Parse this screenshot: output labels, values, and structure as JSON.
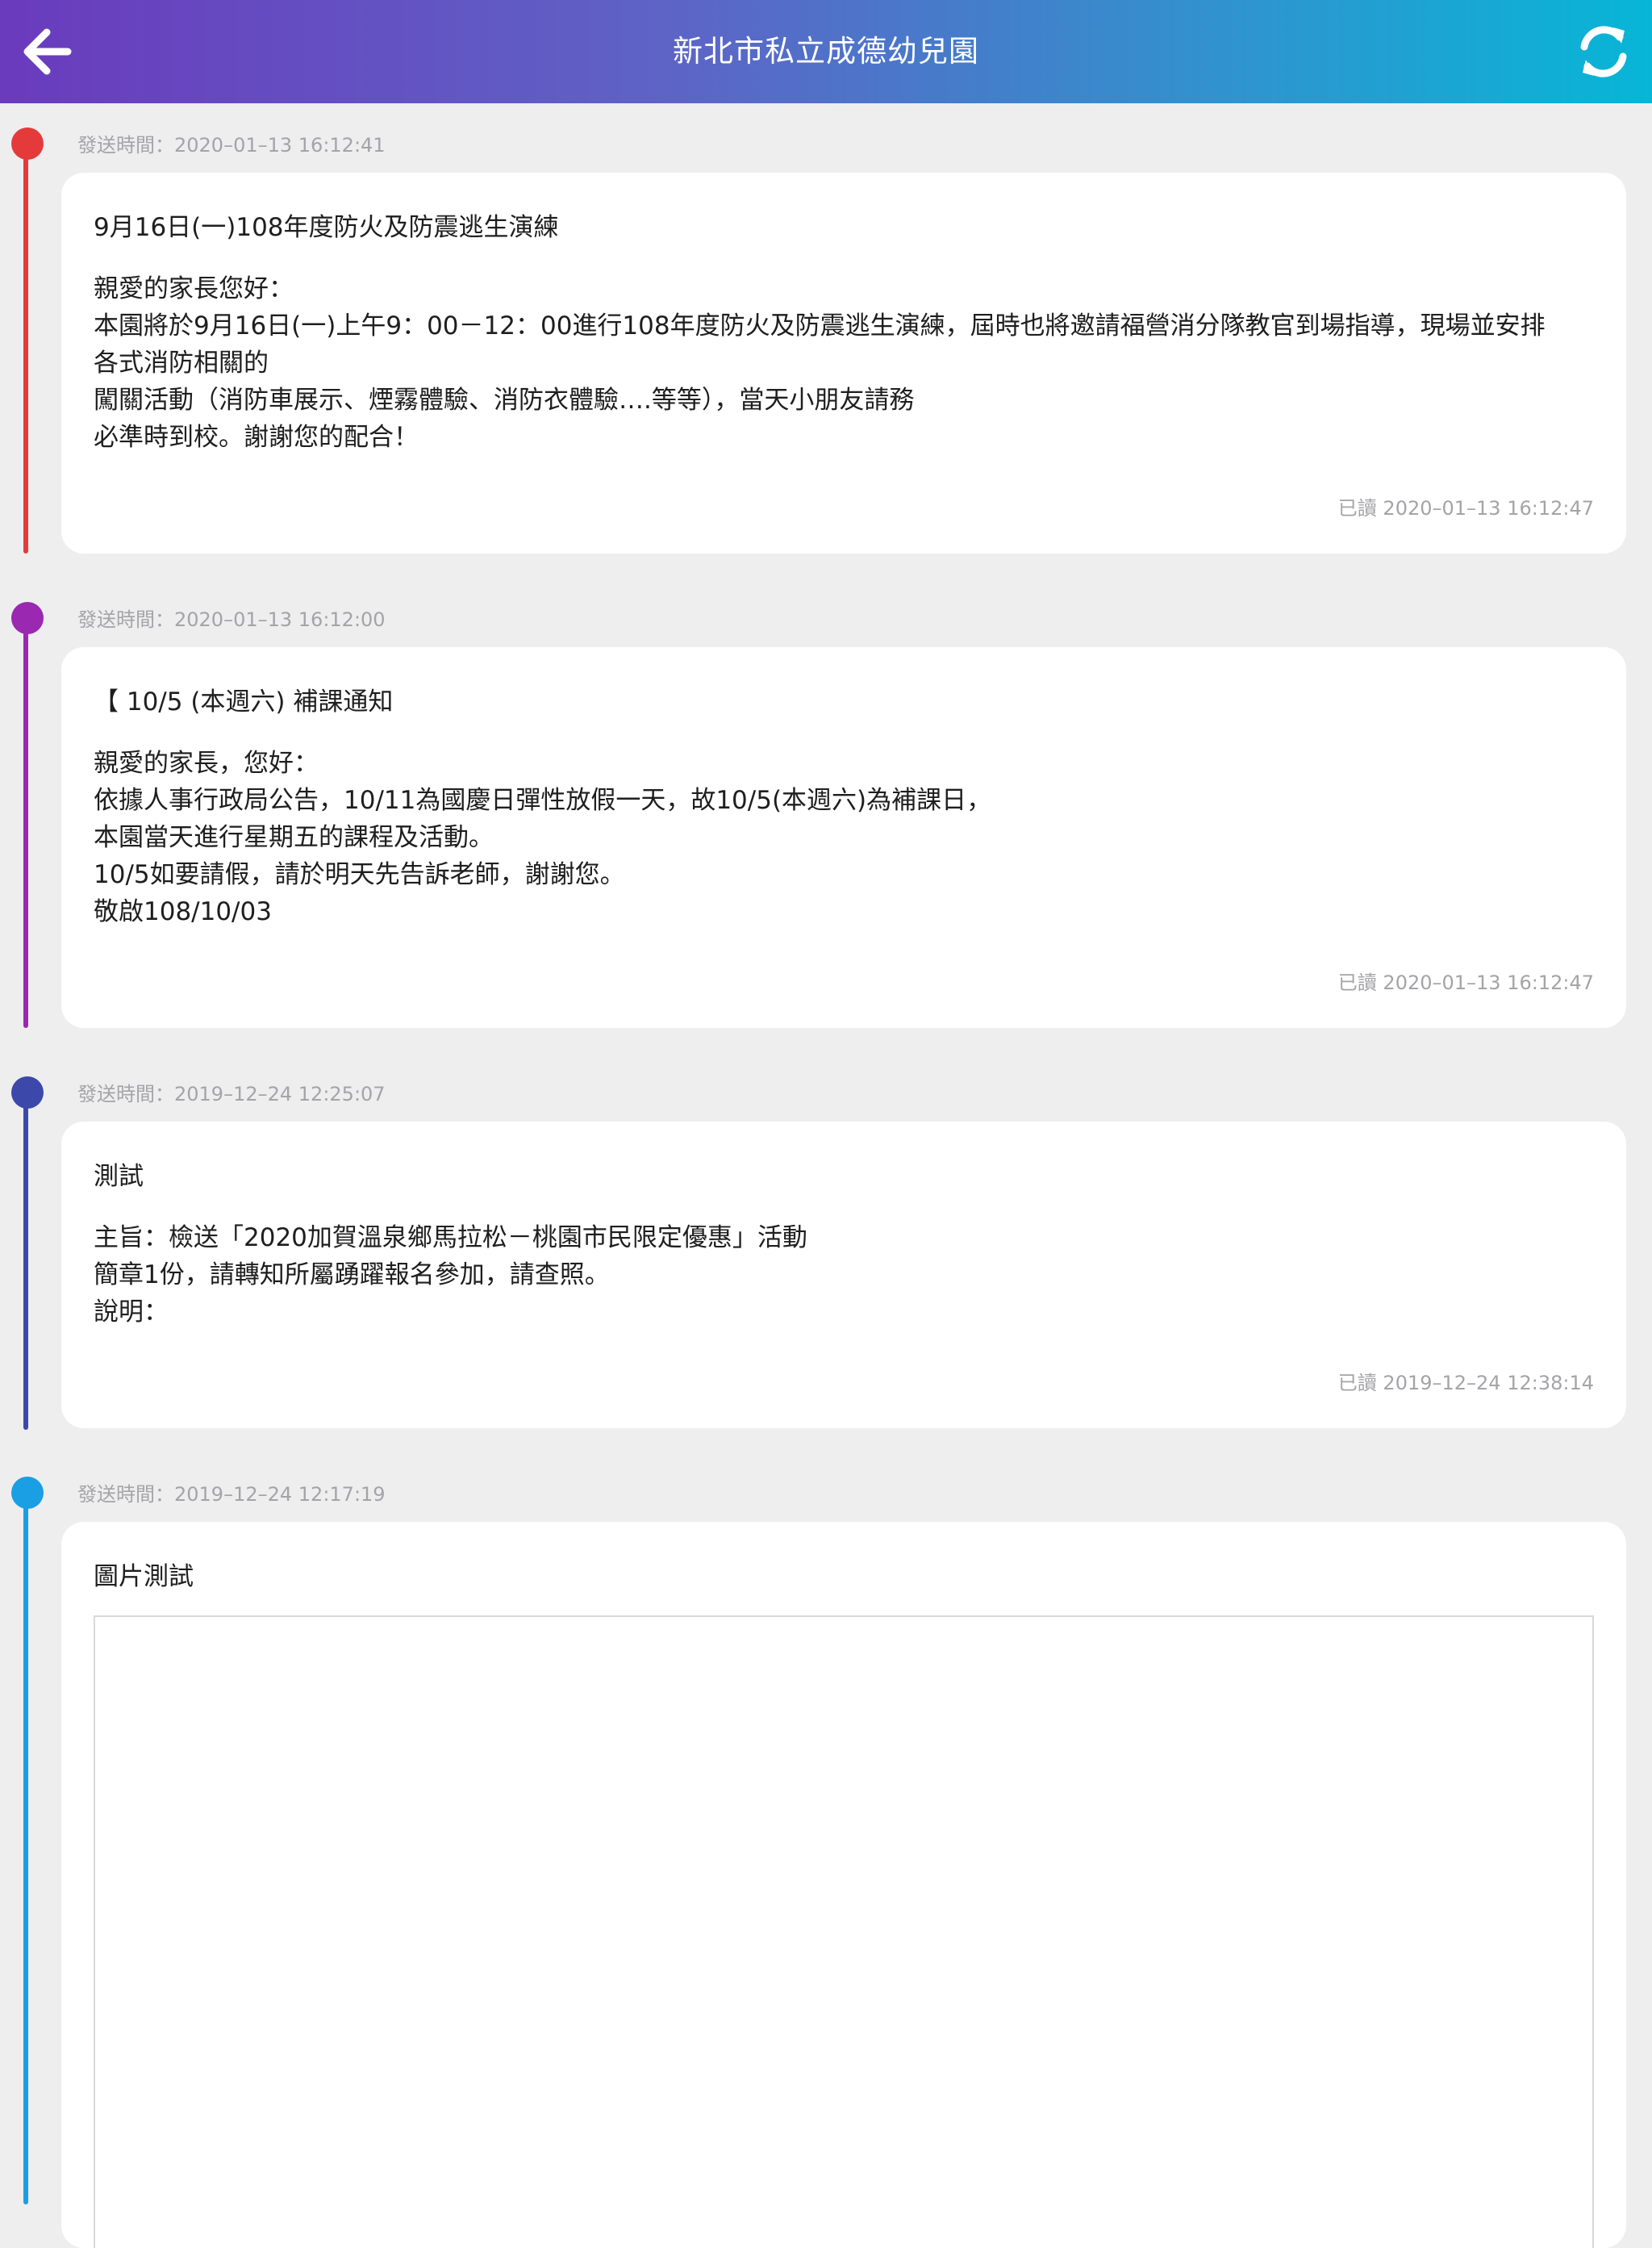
{
  "header": {
    "title": "新北市私立成德幼兒園",
    "back_icon": "arrow-left-icon",
    "refresh_icon": "refresh-icon"
  },
  "colors": {
    "header_gradient_start": "#6a3bbd",
    "header_gradient_end": "#07b6d6",
    "timeline": [
      "#e53a3a",
      "#9b28b0",
      "#3c48aa",
      "#1a9ee4"
    ]
  },
  "messages": [
    {
      "sent": "發送時間：2020–01–13 16:12:41",
      "title": "9月16日(一)108年度防火及防震逃生演練",
      "body": [
        "親愛的家長您好：",
        " 本園將於9月16日(一)上午9：00－12：00進行108年度防火及防震逃生演練，屆時也將邀請福營消分隊教官到場指導，現場並安排",
        "各式消防相關的",
        "闖關活動（消防車展示、煙霧體驗、消防衣體驗….等等），當天小朋友請務",
        "必準時到校。謝謝您的配合！"
      ],
      "read": "已讀 2020–01–13 16:12:47"
    },
    {
      "sent": "發送時間：2020–01–13 16:12:00",
      "title": "【 10/5 (本週六) 補課通知",
      "body": [
        "親愛的家長，您好：",
        "依據人事行政局公告，10/11為國慶日彈性放假一天，故10/5(本週六)為補課日，",
        "本園當天進行星期五的課程及活動。",
        "10/5如要請假，請於明天先告訴老師，謝謝您。",
        "敬啟108/10/03"
      ],
      "read": "已讀 2020–01–13 16:12:47"
    },
    {
      "sent": "發送時間：2019–12–24 12:25:07",
      "title": "測試",
      "body": [
        "主旨：檢送「2020加賀溫泉鄉馬拉松－桃園市民限定優惠」活動",
        "簡章1份，請轉知所屬踴躍報名參加，請查照。",
        "說明："
      ],
      "read": "已讀 2019–12–24 12:38:14"
    },
    {
      "sent": "發送時間：2019–12–24 12:17:19",
      "title": "圖片測試"
    }
  ]
}
